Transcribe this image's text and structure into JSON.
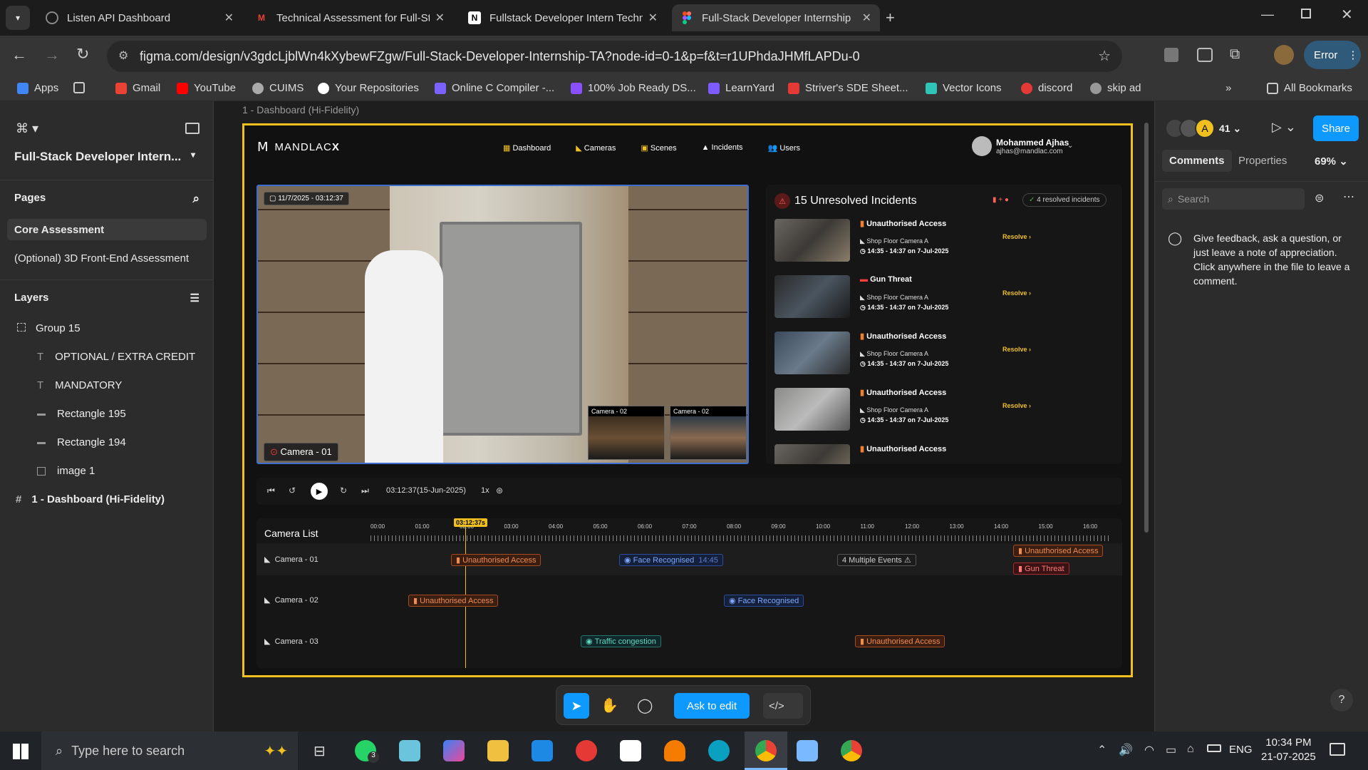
{
  "browser": {
    "tabs": [
      {
        "title": "Listen API Dashboard",
        "icon_color": "#1a1a1a"
      },
      {
        "title": "Technical Assessment for Full-St",
        "icon_color": "#ea4335"
      },
      {
        "title": "Fullstack Developer Intern Techn",
        "icon_color": "#ffffff"
      },
      {
        "title": "Full-Stack Developer Internship",
        "icon_color": "#f24e1e",
        "active": true
      }
    ],
    "url": "figma.com/design/v3gdcLjblWn4kXybewFZgw/Full-Stack-Developer-Internship-TA?node-id=0-1&p=f&t=r1UPhdaJHMfLAPDu-0",
    "profile_error": "Error",
    "bookmarks": [
      {
        "label": "Apps",
        "color": "#4285f4"
      },
      {
        "label": "Gmail",
        "color": "#ea4335"
      },
      {
        "label": "YouTube",
        "color": "#ff0000"
      },
      {
        "label": "CUIMS",
        "color": "#aaaaaa"
      },
      {
        "label": "Your Repositories",
        "color": "#ffffff"
      },
      {
        "label": "Online C Compiler -...",
        "color": "#7b61ff"
      },
      {
        "label": "100% Job Ready DS...",
        "color": "#8a4fff"
      },
      {
        "label": "LearnYard",
        "color": "#7c5cff"
      },
      {
        "label": "Striver's SDE Sheet...",
        "color": "#e53935"
      },
      {
        "label": "Vector Icons",
        "color": "#2ec4b6"
      },
      {
        "label": "discord",
        "color": "#e53935"
      },
      {
        "label": "skip ad",
        "color": "#999999"
      }
    ],
    "all_bookmarks": "All Bookmarks"
  },
  "figma": {
    "file_name": "Full-Stack Developer Intern...",
    "pages_label": "Pages",
    "pages": [
      "Core Assessment",
      "(Optional) 3D Front-End Assessment"
    ],
    "layers_label": "Layers",
    "layers": [
      {
        "name": "Group 15",
        "icon": "group-icon"
      },
      {
        "name": "OPTIONAL / EXTRA CREDIT",
        "icon": "text-icon"
      },
      {
        "name": "MANDATORY",
        "icon": "text-icon"
      },
      {
        "name": "Rectangle 195",
        "icon": "rectangle-icon"
      },
      {
        "name": "Rectangle 194",
        "icon": "rectangle-icon"
      },
      {
        "name": "image 1",
        "icon": "image-icon"
      },
      {
        "name": "1 - Dashboard (Hi-Fidelity)",
        "icon": "frame-icon"
      }
    ],
    "frame_label": "1 - Dashboard (Hi-Fidelity)",
    "collab_count": "41",
    "collab_initial": "A",
    "share": "Share",
    "right_tabs": [
      "Comments",
      "Properties"
    ],
    "zoom": "69%",
    "search_placeholder": "Search",
    "comment_hint": "Give feedback, ask a question, or just leave a note of appreciation. Click anywhere in the file to leave a comment.",
    "ask_to_edit": "Ask to edit",
    "help": "?"
  },
  "dashboard": {
    "brand": "MANDLAC",
    "brand_x": "X",
    "nav": [
      "Dashboard",
      "Cameras",
      "Scenes",
      "Incidents",
      "Users"
    ],
    "user_name": "Mohammed Ajhas",
    "user_email": "ajhas@mandlac.com",
    "feed_timestamp": "11/7/2025 - 03:12:37",
    "feed_camera": "Camera - 01",
    "mini_cams": [
      "Camera - 02",
      "Camera - 02"
    ],
    "incidents_title": "15 Unresolved Incidents",
    "resolved_badge": "4 resolved incidents",
    "incidents": [
      {
        "type": "Unauthorised Access",
        "camera": "Shop Floor Camera A",
        "time": "14:35 - 14:37 on 7-Jul-2025",
        "action": "Resolve",
        "color": "#f08030"
      },
      {
        "type": "Gun Threat",
        "camera": "Shop Floor Camera A",
        "time": "14:35 - 14:37 on 7-Jul-2025",
        "action": "Resolve",
        "color": "#ff3b3b"
      },
      {
        "type": "Unauthorised Access",
        "camera": "Shop Floor Camera A",
        "time": "14:35 - 14:37 on 7-Jul-2025",
        "action": "Resolve",
        "color": "#f08030"
      },
      {
        "type": "Unauthorised Access",
        "camera": "Shop Floor Camera A",
        "time": "14:35 - 14:37 on 7-Jul-2025",
        "action": "Resolve",
        "color": "#f08030"
      },
      {
        "type": "Unauthorised Access",
        "color": "#f08030"
      }
    ],
    "playback_time": "03:12:37(15-Jun-2025)",
    "speed": "1x",
    "camera_list": "Camera List",
    "playhead": "03:12:37s",
    "hours": [
      "00:00",
      "01:00",
      "02:00",
      "03:00",
      "04:00",
      "05:00",
      "06:00",
      "07:00",
      "08:00",
      "09:00",
      "10:00",
      "11:00",
      "12:00",
      "13:00",
      "14:00",
      "15:00",
      "16:00"
    ],
    "cameras": [
      "Camera - 01",
      "Camera - 02",
      "Camera - 03"
    ],
    "events": {
      "cam1": [
        "Unauthorised Access",
        "Face Recognised",
        "14:45",
        "4 Multiple Events",
        "Unauthorised Access",
        "Gun Threat"
      ],
      "cam2": [
        "Unauthorised Access",
        "Face Recognised"
      ],
      "cam3": [
        "Traffic congestion",
        "Unauthorised Access"
      ]
    }
  },
  "taskbar": {
    "search_placeholder": "Type here to search",
    "lang": "ENG",
    "time": "10:34 PM",
    "date": "21-07-2025",
    "whatsapp_badge": "3"
  }
}
